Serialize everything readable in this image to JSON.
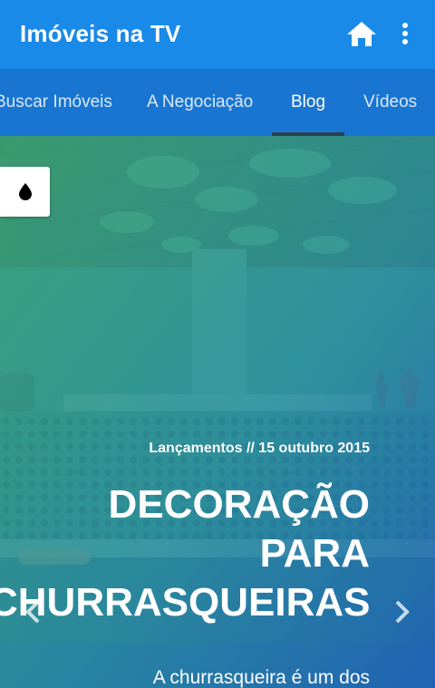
{
  "appbar": {
    "title": "Imóveis na TV",
    "home_icon": "home-icon",
    "menu_icon": "more-vert-icon",
    "color": "#1a8ae8"
  },
  "tabs": [
    {
      "label": "Buscar Imóveis",
      "active": false
    },
    {
      "label": "A Negociação",
      "active": false
    },
    {
      "label": "Blog",
      "active": true
    },
    {
      "label": "Vídeos",
      "active": false
    }
  ],
  "tabs_color": "#1875d1",
  "hero": {
    "drop_button_icon": "water-drop-icon",
    "meta": "Lançamentos // 15 outubro 2015",
    "headline_lines": [
      "DECORAÇÃO",
      "PARA",
      "CHURRASQUEIRAS"
    ],
    "excerpt": "A churrasqueira é um dos",
    "prev_icon": "chevron-left-icon",
    "next_icon": "chevron-right-icon"
  }
}
